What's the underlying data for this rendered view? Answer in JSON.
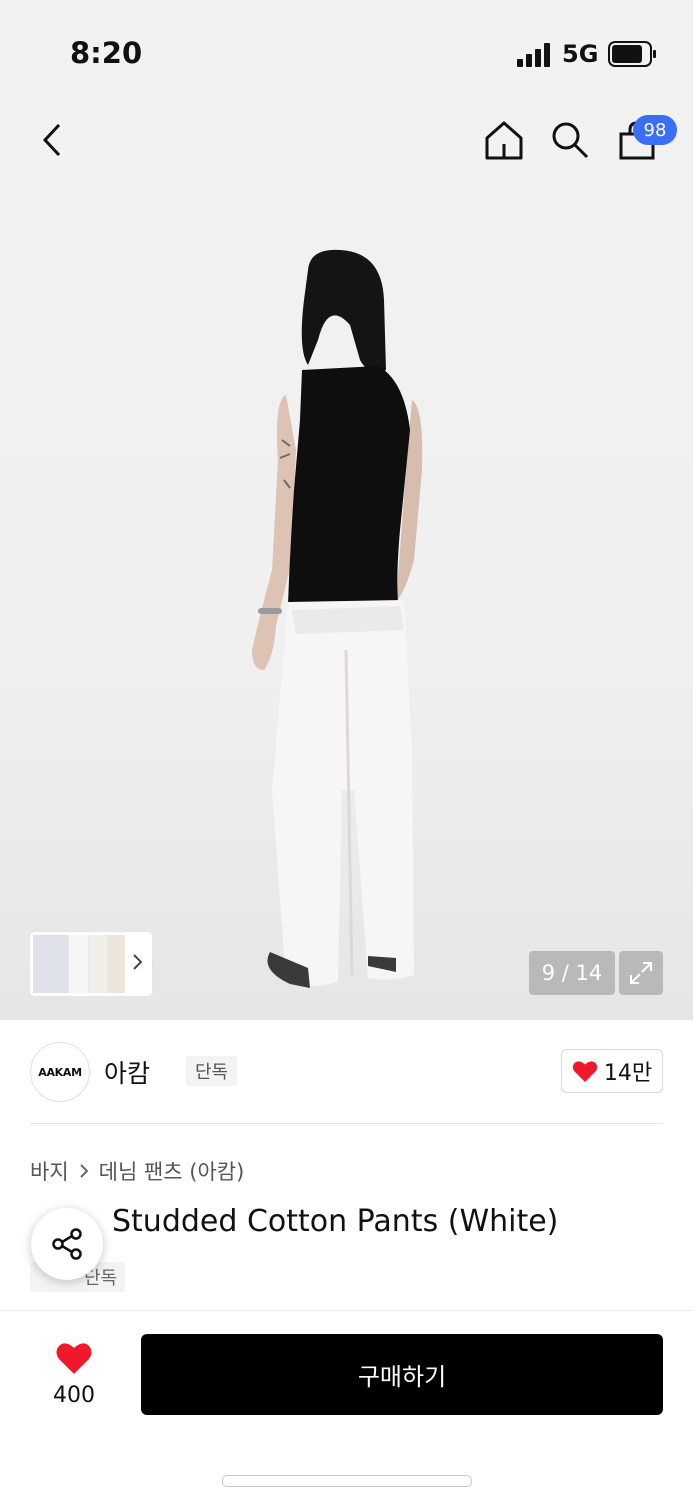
{
  "status_bar": {
    "time": "8:20",
    "network": "5G"
  },
  "nav": {
    "cart_count": "98",
    "back_icon": "chevron-left-icon",
    "home_icon": "home-icon",
    "search_icon": "search-icon",
    "cart_icon": "shopping-bag-icon"
  },
  "gallery": {
    "counter": "9 / 14",
    "current": 9,
    "total": 14
  },
  "brand": {
    "logo_text": "AAKAM",
    "name": "아캄",
    "tag": "단독",
    "likes": "14만"
  },
  "breadcrumb": {
    "category": "바지",
    "subcategory": "데님 팬츠 (아캄)"
  },
  "product": {
    "name_visible": "Studded Cotton Pants (White)",
    "tag_visible": "단독"
  },
  "bottom": {
    "wish_count": "400",
    "buy_label": "구매하기"
  },
  "colors": {
    "accent": "#3b6ef5",
    "heart": "#f0182b",
    "buy": "#000000"
  }
}
